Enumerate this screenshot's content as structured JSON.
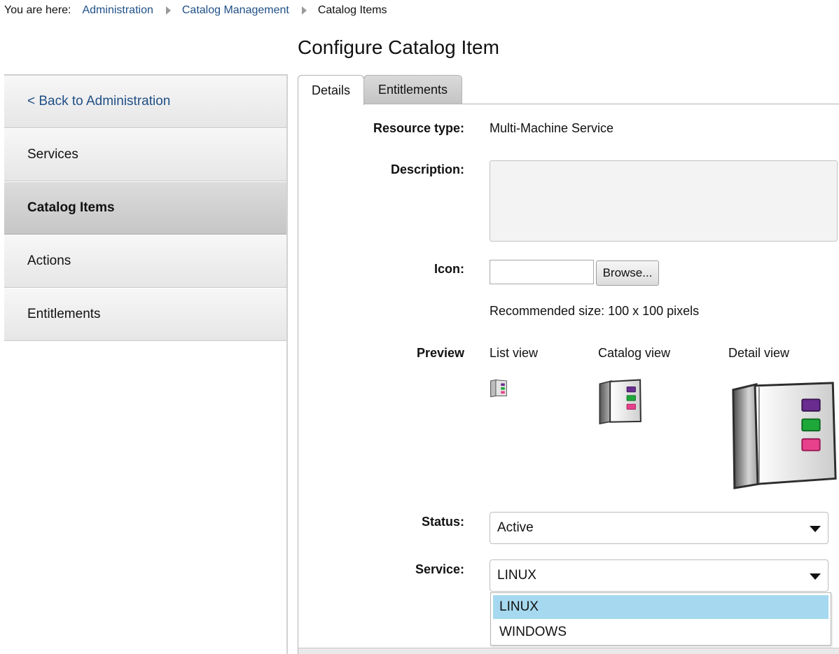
{
  "breadcrumb": {
    "prefix": "You are here:",
    "items": [
      "Administration",
      "Catalog Management",
      "Catalog Items"
    ]
  },
  "page": {
    "title": "Configure Catalog Item"
  },
  "sidebar": {
    "items": [
      {
        "label": "< Back to Administration"
      },
      {
        "label": "Services"
      },
      {
        "label": "Catalog Items"
      },
      {
        "label": "Actions"
      },
      {
        "label": "Entitlements"
      }
    ],
    "active": "Catalog Items"
  },
  "tabs": [
    {
      "label": "Details"
    },
    {
      "label": "Entitlements"
    }
  ],
  "active_tab": "Details",
  "form": {
    "resource_type": {
      "label": "Resource type:",
      "value": "Multi-Machine Service"
    },
    "description": {
      "label": "Description:",
      "value": ""
    },
    "icon": {
      "label": "Icon:",
      "value": "",
      "browse_label": "Browse...",
      "hint": "Recommended size: 100 x 100 pixels"
    },
    "preview": {
      "label": "Preview",
      "views": [
        {
          "label": "List view"
        },
        {
          "label": "Catalog view"
        },
        {
          "label": "Detail view"
        }
      ],
      "icon_name": "book-catalog-icon",
      "swatch_colors": [
        "#6a2c91",
        "#1fa83a",
        "#e8418c"
      ]
    },
    "status": {
      "label": "Status:",
      "value": "Active"
    },
    "service": {
      "label": "Service:",
      "value": "LINUX",
      "options": [
        "LINUX",
        "WINDOWS"
      ],
      "highlighted_option": "LINUX"
    }
  },
  "colors": {
    "link": "#1f4f86",
    "dropdown_highlight": "#a6d9ef"
  }
}
